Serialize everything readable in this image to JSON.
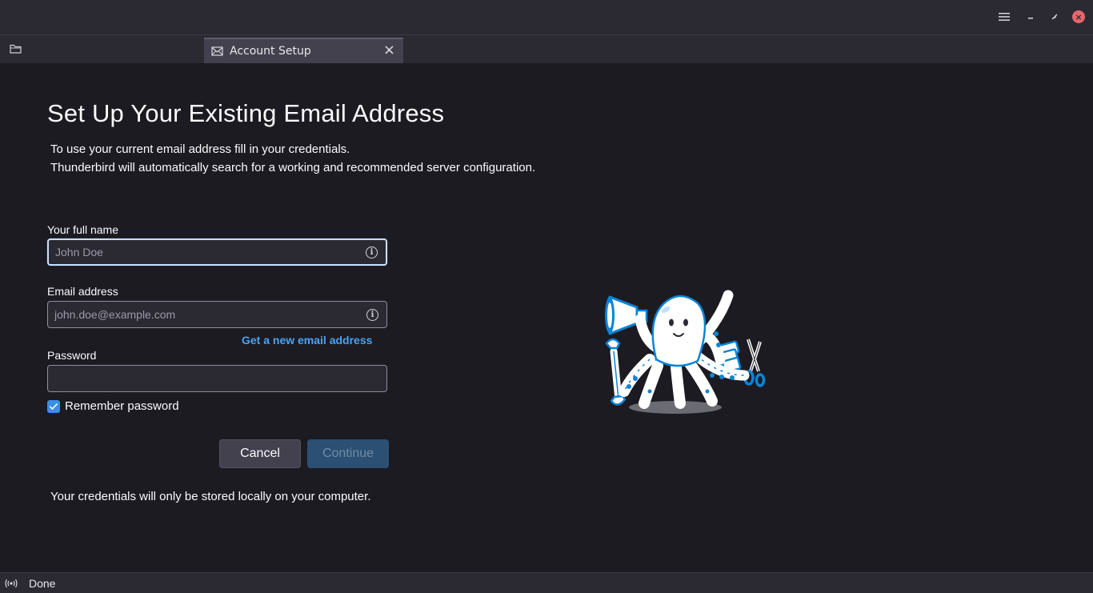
{
  "window": {
    "menu_icon": "hamburger-menu-icon",
    "minimize_icon": "minimize-icon",
    "maximize_icon": "restore-icon",
    "close_icon": "close-icon"
  },
  "tabs": {
    "folder_icon": "folder-icon",
    "active": {
      "label": "Account Setup",
      "icon": "envelope-icon",
      "close": "×"
    }
  },
  "main": {
    "title": "Set Up Your Existing Email Address",
    "description_line1": "To use your current email address fill in your credentials.",
    "description_line2": "Thunderbird will automatically search for a working and recommended server configuration.",
    "full_name": {
      "label": "Your full name",
      "placeholder": "John Doe",
      "value": ""
    },
    "email": {
      "label": "Email address",
      "placeholder": "john.doe@example.com",
      "value": ""
    },
    "new_email_link": "Get a new email address",
    "password": {
      "label": "Password",
      "value": ""
    },
    "remember_password": {
      "label": "Remember password",
      "checked": true
    },
    "cancel_label": "Cancel",
    "continue_label": "Continue",
    "footnote": "Your credentials will only be stored locally on your computer."
  },
  "status": {
    "icon": "connection-status-icon",
    "text": "Done"
  },
  "colors": {
    "background": "#1c1b22",
    "chrome": "#2b2a33",
    "accent": "#4aa3f5",
    "checkbox": "#3a8ee6",
    "close": "#e6666b"
  }
}
